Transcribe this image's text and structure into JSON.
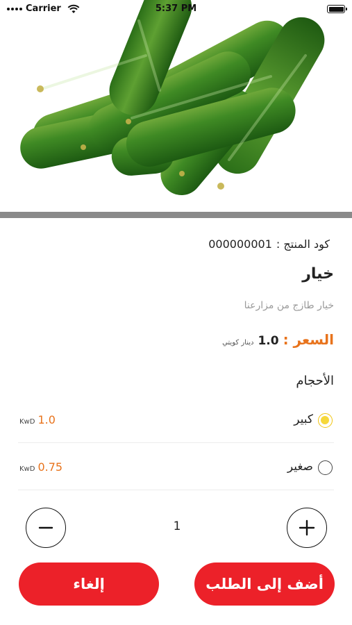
{
  "status_bar": {
    "carrier": "Carrier",
    "time": "5:37 PM"
  },
  "product": {
    "image_alt": "cucumbers",
    "code_label": "كود المنتج :",
    "code_value": "000000001",
    "name": "خيار",
    "description": "خيار طازج من مزارعنا",
    "price_label": "السعر :",
    "price_value": "1.0",
    "price_currency": "دينار كويتي"
  },
  "sizes": {
    "title": "الأحجام",
    "options": [
      {
        "name": "كبير",
        "currency": "KwD",
        "price": "1.0",
        "selected": true
      },
      {
        "name": "صغير",
        "currency": "KwD",
        "price": "0.75",
        "selected": false
      }
    ]
  },
  "quantity": {
    "value": "1"
  },
  "actions": {
    "cancel_label": "إلغاء",
    "add_label": "أضف إلى الطلب"
  },
  "colors": {
    "accent_orange": "#e8731c",
    "button_red": "#ec2129",
    "radio_selected": "#f6d83a"
  }
}
